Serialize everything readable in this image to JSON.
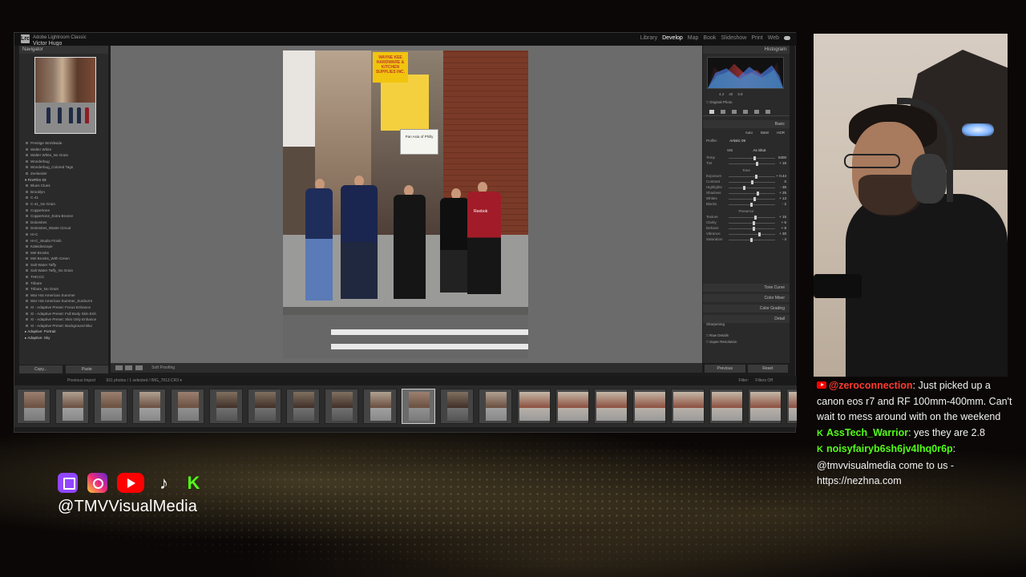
{
  "lightroom": {
    "logo": "Lrc",
    "catalog_line": "Adobe Lightroom Classic",
    "user": "Victor Hugo",
    "modules": [
      "Library",
      "Develop",
      "Map",
      "Book",
      "Slideshow",
      "Print",
      "Web"
    ],
    "active_module": "Develop",
    "left_panel": {
      "navigator_label": "Navigator",
      "presets": [
        {
          "label": "Prestige Worldwide",
          "group": false
        },
        {
          "label": "Walter White",
          "group": false
        },
        {
          "label": "Walter White_No Grain",
          "group": false
        },
        {
          "label": "Wonderbug",
          "group": false
        },
        {
          "label": "Wonderbug_Colored Tags",
          "group": false
        },
        {
          "label": "Zeelander",
          "group": false
        },
        {
          "label": "▾ FireFilm 03",
          "group": true
        },
        {
          "label": "Blues Clues",
          "group": false
        },
        {
          "label": "Brooklyn",
          "group": false
        },
        {
          "label": "C-41",
          "group": false
        },
        {
          "label": "C-41_No Grain",
          "group": false
        },
        {
          "label": "Coppertone",
          "group": false
        },
        {
          "label": "Coppertone_Extra Bronze",
          "group": false
        },
        {
          "label": "Dolomites",
          "group": false
        },
        {
          "label": "Dolomites_Waste Circuit",
          "group": false
        },
        {
          "label": "HI-C",
          "group": false
        },
        {
          "label": "HI-C_Studio Finish",
          "group": false
        },
        {
          "label": "Kaleidoscope",
          "group": false
        },
        {
          "label": "Mel Brooks",
          "group": false
        },
        {
          "label": "Mel Brooks_With Green",
          "group": false
        },
        {
          "label": "Salt Water Taffy",
          "group": false
        },
        {
          "label": "Salt Water Taffy_No Grain",
          "group": false
        },
        {
          "label": "THICCC",
          "group": false
        },
        {
          "label": "Tribute",
          "group": false
        },
        {
          "label": "Tribute_No Grain",
          "group": false
        },
        {
          "label": "War Hot American Summer",
          "group": false
        },
        {
          "label": "War Hot American Summer_Sunburnt",
          "group": false
        },
        {
          "label": "XI - Adaptive Preset: Focus Enhance",
          "group": false
        },
        {
          "label": "XI - Adaptive Preset: Full Body Skin Enh",
          "group": false
        },
        {
          "label": "XI - Adaptive Preset: Skin Only Enhance",
          "group": false
        },
        {
          "label": "XI - Adaptive Preset: Background Blur",
          "group": false
        },
        {
          "label": "▸ Adaptive: Portrait",
          "group": true
        },
        {
          "label": "▸ Adaptive: Sky",
          "group": true
        }
      ],
      "copy_button": "Copy...",
      "paste_button": "Paste"
    },
    "center": {
      "photo_signs": [
        "WAYNE KEE HARDWARE & KITCHEN SUPPLIES INC.",
        "Pan Asia of Philly"
      ],
      "person_logo": "Reebok",
      "toolbar_label": "Soft Proofing"
    },
    "right_panel": {
      "histogram_label": "Histogram",
      "histo_readout": [
        "4.4",
        "40",
        "3.9"
      ],
      "original_label": "□ Original Photo",
      "basic_label": "Basic",
      "treatment_options": [
        "Auto",
        "B&W",
        "HDR"
      ],
      "profile": "Artistic 09",
      "wb_label": "WB",
      "wb_value": "As Shot",
      "sliders": [
        {
          "label": "Temp",
          "value": "5300",
          "pos": 0.55
        },
        {
          "label": "Tint",
          "value": "+ 16",
          "pos": 0.6
        },
        {
          "label": "Tone",
          "value": "",
          "pos": null
        },
        {
          "label": "Exposure",
          "value": "+ 0.44",
          "pos": 0.58
        },
        {
          "label": "Contrast",
          "value": "0",
          "pos": 0.5
        },
        {
          "label": "Highlights",
          "value": "- 36",
          "pos": 0.32
        },
        {
          "label": "Shadows",
          "value": "+ 25",
          "pos": 0.62
        },
        {
          "label": "Whites",
          "value": "+ 13",
          "pos": 0.56
        },
        {
          "label": "Blacks",
          "value": "- 2",
          "pos": 0.49
        },
        {
          "label": "Presence",
          "value": "",
          "pos": null
        },
        {
          "label": "Texture",
          "value": "+ 15",
          "pos": 0.57
        },
        {
          "label": "Clarity",
          "value": "+ 6",
          "pos": 0.53
        },
        {
          "label": "Dehaze",
          "value": "+ 8",
          "pos": 0.54
        },
        {
          "label": "Vibrance",
          "value": "+ 30",
          "pos": 0.65
        },
        {
          "label": "Saturation",
          "value": "- 4",
          "pos": 0.48
        }
      ],
      "sections": [
        "Tone Curve",
        "Color Mixer",
        "Color Grading",
        "Detail"
      ],
      "detail_sharpening": "Sharpening",
      "raw_details": "□ Raw Details",
      "super_resolution": "□ Super Resolution",
      "previous_button": "Previous",
      "reset_button": "Reset"
    },
    "filmstrip_bar": {
      "source": "Previous Import",
      "info": "931 photos / 1 selected / IMG_7813.CR3 ▾",
      "filter": "Filter:",
      "filter_value": "Filters Off"
    },
    "filmstrip_count": 21,
    "filmstrip_selected": 10
  },
  "socials": {
    "icons": [
      "twitch-icon",
      "instagram-icon",
      "youtube-icon",
      "tiktok-icon",
      "kick-icon"
    ],
    "handle": "@TMVVisualMedia"
  },
  "chat": [
    {
      "platform": "youtube",
      "user": "@zeroconnection",
      "message": ": Just picked up a canon eos r7 and RF 100mm-400mm. Can't wait to mess around with on the weekend"
    },
    {
      "platform": "kick",
      "user": "AssTech_Warrior",
      "message": ": yes they are 2.8"
    },
    {
      "platform": "kick",
      "user": "noisyfairyb6sh6jv4lhq0r6p",
      "message": ":\n@tmvvisualmedia come to us - https://nezhna.com"
    }
  ],
  "colors": {
    "twitch": "#9146ff",
    "youtube": "#ff0000",
    "kick": "#53fc18",
    "lr_bg": "#1c1c1c",
    "center_bg": "#6b6b6b"
  }
}
